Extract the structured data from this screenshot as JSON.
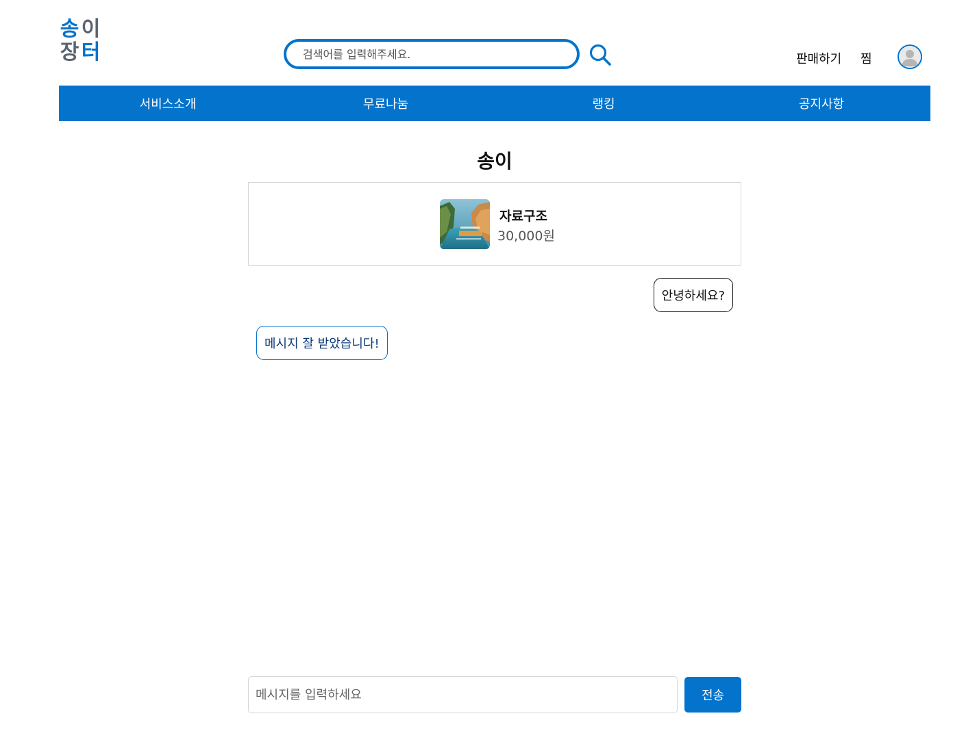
{
  "header": {
    "logo": {
      "chars": [
        "송",
        "이",
        "장",
        "터"
      ],
      "brand_color": "#0473cc",
      "secondary_color": "#5a6470"
    },
    "search": {
      "placeholder": "검색어를 입력해주세요.",
      "value": "",
      "icon": "search-icon"
    },
    "links": {
      "sell": "판매하기",
      "wishlist": "찜"
    },
    "profile_icon": "user-avatar-icon"
  },
  "nav": {
    "items": [
      "서비스소개",
      "무료나눔",
      "랭킹",
      "공지사항"
    ]
  },
  "chat": {
    "partner_name": "송이",
    "product": {
      "name": "자료구조",
      "price": "30,000원",
      "thumbnail": "book-cover-image"
    },
    "messages": [
      {
        "direction": "sent",
        "text": "안녕하세요?"
      },
      {
        "direction": "received",
        "text": "메시지 잘 받았습니다!"
      }
    ],
    "composer": {
      "placeholder": "메시지를 입력하세요",
      "value": "",
      "send_label": "전송"
    }
  },
  "colors": {
    "accent": "#0473cc",
    "nav_text": "#ffffff"
  }
}
